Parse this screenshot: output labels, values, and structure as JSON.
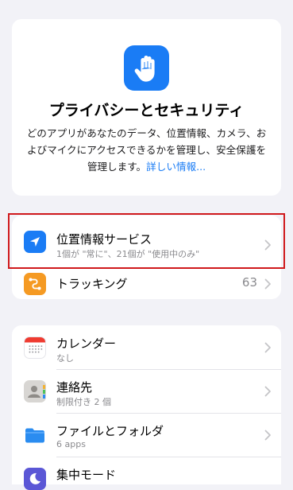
{
  "hero": {
    "title": "プライバシーとセキュリティ",
    "description": "どのアプリがあなたのデータ、位置情報、カメラ、およびマイクにアクセスできるかを管理し、安全保護を管理します。",
    "link": "詳しい情報..."
  },
  "group1": [
    {
      "title": "位置情報サービス",
      "subtitle": "1個が \"常に\"、21個が \"使用中のみ\"",
      "icon": "location-arrow-icon",
      "color": "#1a7cf5"
    },
    {
      "title": "トラッキング",
      "value": "63",
      "icon": "tracking-icon",
      "color": "#f59a23"
    }
  ],
  "group2": [
    {
      "title": "カレンダー",
      "subtitle": "なし",
      "icon": "calendar-icon"
    },
    {
      "title": "連絡先",
      "subtitle": "制限付き 2 個",
      "icon": "contacts-icon"
    },
    {
      "title": "ファイルとフォルダ",
      "subtitle": "6 apps",
      "icon": "folder-icon",
      "color": "#2a8cf0"
    },
    {
      "title": "集中モード",
      "icon": "focus-moon-icon",
      "color": "#5b57d6"
    }
  ],
  "colors": {
    "accent": "#1a7cf5",
    "highlight": "#d0191c"
  }
}
